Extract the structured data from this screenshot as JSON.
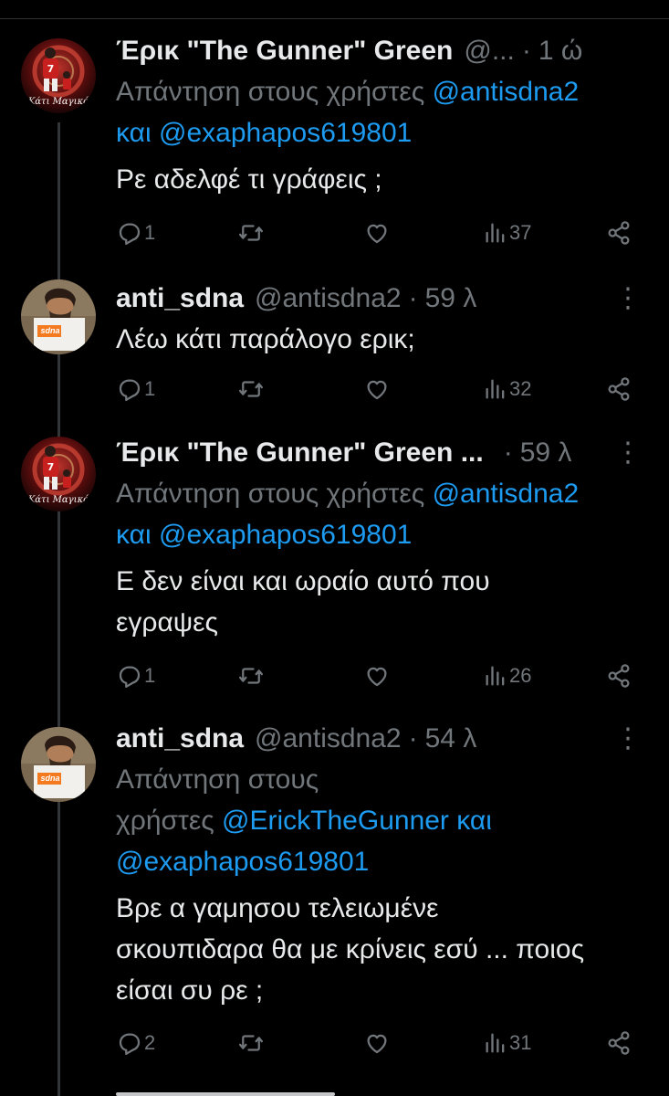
{
  "tweets": [
    {
      "name": "Έρικ \"The Gunner\" Green",
      "handle": "@...",
      "dot": "·",
      "time": "1 ώ",
      "more": "⋮",
      "reply_prefix": "Απάντηση στους χρήστες",
      "reply_mention_1": "@antisdna2",
      "reply_join": "και",
      "reply_mention_2": "@exaphapos619801",
      "text": "Ρε αδελφέ τι γράφεις ;",
      "replies": "1",
      "views": "37",
      "avatar_caption": "Κάτι Μαγικό"
    },
    {
      "name": "anti_sdna",
      "handle": "@antisdna2",
      "dot": "·",
      "time": "59 λ",
      "more": "⋮",
      "text": "Λέω κάτι παράλογο ερικ;",
      "replies": "1",
      "views": "32",
      "avatar_sign": "sdna"
    },
    {
      "name": "Έρικ \"The Gunner\" Green ...",
      "dot": "·",
      "time": "59 λ",
      "more": "⋮",
      "reply_prefix": "Απάντηση στους χρήστες",
      "reply_mention_1": "@antisdna2",
      "reply_join": "και",
      "reply_mention_2": "@exaphapos619801",
      "text_line_1": "Ε δεν είναι και ωραίο αυτό που",
      "text_line_2": "εγραψες",
      "replies": "1",
      "views": "26",
      "avatar_caption": "Κάτι Μαγικό"
    },
    {
      "name": "anti_sdna",
      "handle": "@antisdna2",
      "dot": "·",
      "time": "54 λ",
      "more": "⋮",
      "reply_prefix_1": "Απάντηση στους",
      "reply_prefix_2": "χρήστες",
      "reply_mention_1": "@ErickTheGunner",
      "reply_join": "και",
      "reply_mention_2": "@exaphapos619801",
      "text_line_1": "Βρε α γαμησου τελειωμένε",
      "text_line_2": "σκουπιδαρα θα με κρίνεις εσύ ... ποιος",
      "text_line_3": "είσαι συ ρε ;",
      "replies": "2",
      "views": "31",
      "avatar_sign": "sdna"
    }
  ],
  "colors": {
    "background": "#000000",
    "text": "#e7e9ea",
    "secondary": "#71767b",
    "accent": "#1d9bf0",
    "thread_line": "#333639"
  },
  "icons": [
    "reply-icon",
    "retweet-icon",
    "like-icon",
    "views-icon",
    "share-icon",
    "more-icon"
  ]
}
